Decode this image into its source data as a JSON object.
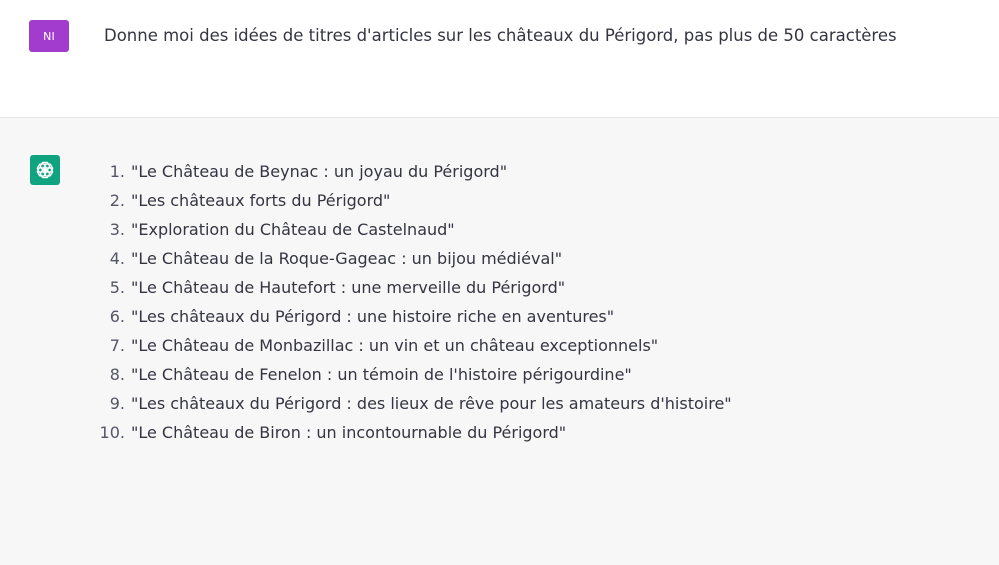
{
  "user_message": {
    "avatar_initials": "NI",
    "avatar_color": "#a23ccf",
    "text": "Donne moi des idées de titres d'articles sur les châteaux du Périgord, pas plus de 50 caractères"
  },
  "assistant_message": {
    "avatar_icon": "openai-logo-icon",
    "avatar_color": "#10a37f",
    "items": [
      {
        "number": "1.",
        "text": "\"Le Château de Beynac : un joyau du Périgord\""
      },
      {
        "number": "2.",
        "text": "\"Les châteaux forts du Périgord\""
      },
      {
        "number": "3.",
        "text": "\"Exploration du Château de Castelnaud\""
      },
      {
        "number": "4.",
        "text": "\"Le Château de la Roque-Gageac : un bijou médiéval\""
      },
      {
        "number": "5.",
        "text": "\"Le Château de Hautefort : une merveille du Périgord\""
      },
      {
        "number": "6.",
        "text": "\"Les châteaux du Périgord : une histoire riche en aventures\""
      },
      {
        "number": "7.",
        "text": "\"Le Château de Monbazillac : un vin et un château exceptionnels\""
      },
      {
        "number": "8.",
        "text": "\"Le Château de Fenelon : un témoin de l'histoire périgourdine\""
      },
      {
        "number": "9.",
        "text": "\"Les châteaux du Périgord : des lieux de rêve pour les amateurs d'histoire\""
      },
      {
        "number": "10.",
        "text": "\"Le Château de Biron : un incontournable du Périgord\""
      }
    ]
  }
}
